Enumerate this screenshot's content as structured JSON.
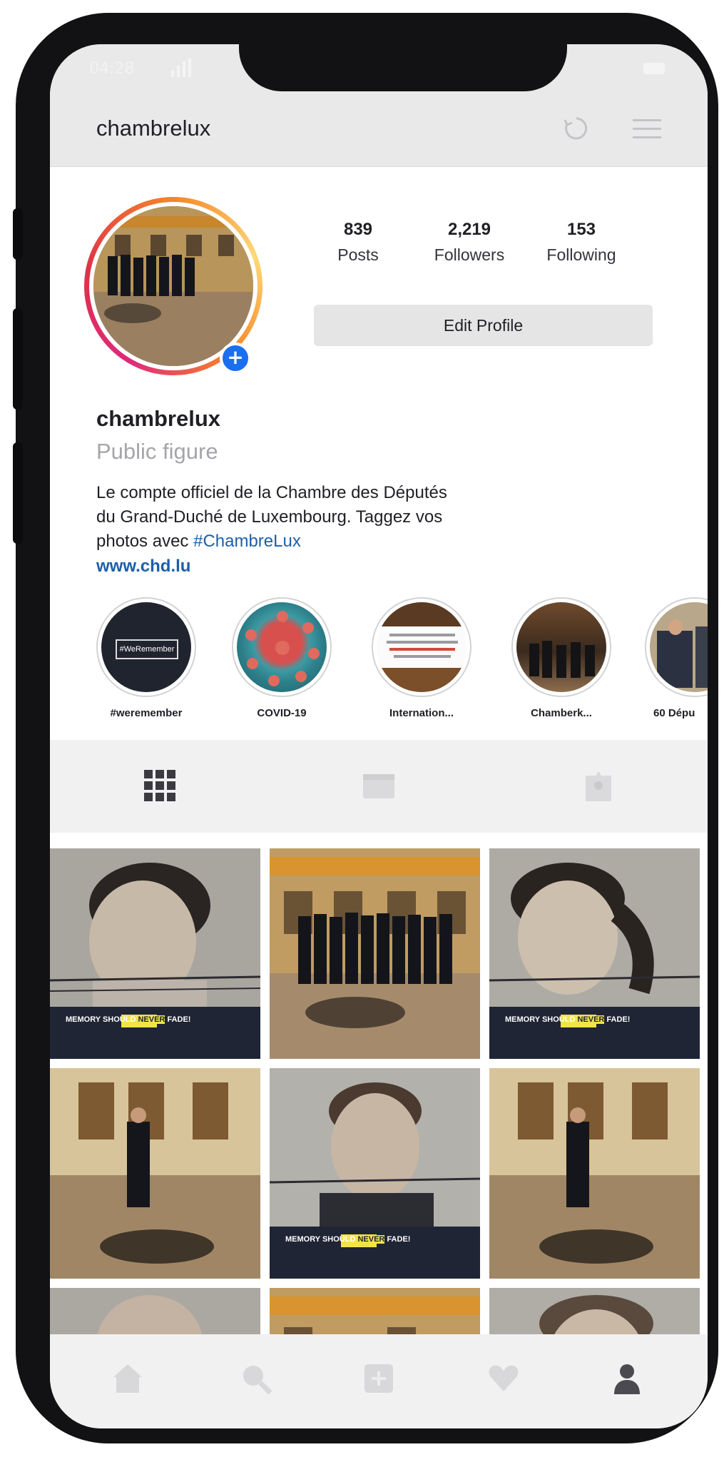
{
  "status_bar": {
    "time": "04:28"
  },
  "header": {
    "username": "chambrelux"
  },
  "profile": {
    "stats": [
      {
        "value": "839",
        "label": "Posts"
      },
      {
        "value": "2,219",
        "label": "Followers"
      },
      {
        "value": "153",
        "label": "Following"
      }
    ],
    "edit_label": "Edit Profile",
    "name": "chambrelux",
    "category": "Public figure",
    "bio_lines": [
      "Le compte officiel de la Chambre des Députés",
      "du Grand-Duché de Luxembourg. Taggez vos",
      "photos avec"
    ],
    "hashtag": "#ChambreLux",
    "link": "www.chd.lu"
  },
  "highlights": [
    {
      "label": "#weremember",
      "badge_text": "#WeRemember"
    },
    {
      "label": "COVID-19"
    },
    {
      "label": "Internation..."
    },
    {
      "label": "Chamberk..."
    },
    {
      "label": "60 Dépu"
    }
  ],
  "grid": {
    "poster_slogan_before": "MEMORY SHOULD",
    "poster_slogan_highlight": "NEVER",
    "poster_slogan_after": "FADE!"
  },
  "colors": {
    "link_blue": "#1d5fa8",
    "add_badge_blue": "#1a6ef0",
    "poster_navy": "#1f2534",
    "poster_highlight": "#f2e34a"
  },
  "icons": {
    "header": [
      "history-icon",
      "menu-icon"
    ],
    "tabs": [
      "grid-icon",
      "igtv-icon",
      "tagged-icon"
    ],
    "bottom_nav": [
      "home-icon",
      "search-icon",
      "add-post-icon",
      "heart-icon",
      "profile-icon"
    ]
  }
}
